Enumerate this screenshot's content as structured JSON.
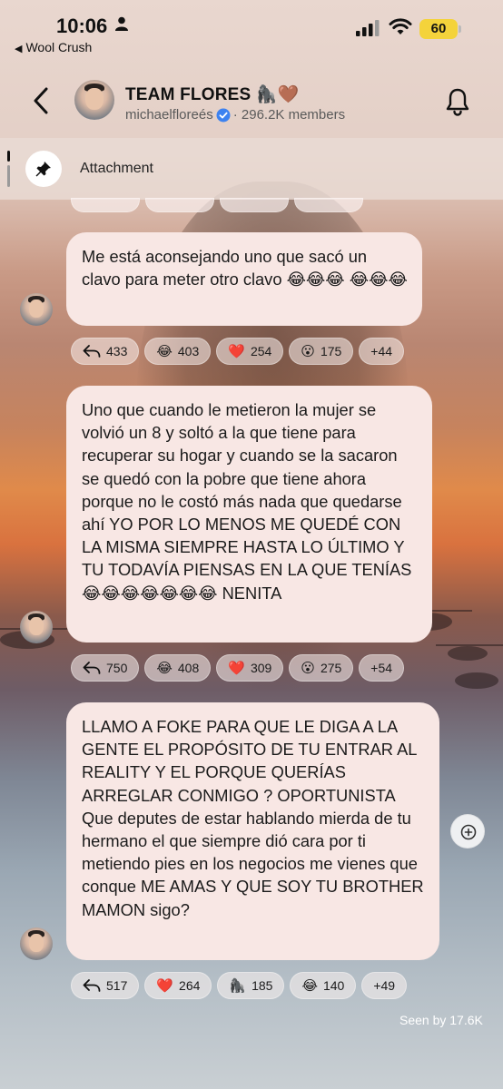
{
  "status_bar": {
    "time": "10:06",
    "back_app": "Wool Crush",
    "battery": "60"
  },
  "header": {
    "title": "TEAM FLORES 🦍🤎",
    "handle": "michaelfloreés",
    "members": "· 296.2K members"
  },
  "pinned": {
    "label": "Attachment"
  },
  "messages": [
    {
      "text": "Me está aconsejando uno que sacó un clavo para meter otro clavo 😂😂😂 😂😂😂",
      "reactions": [
        {
          "icon": "reply-icon",
          "count": "433"
        },
        {
          "emoji": "😂",
          "count": "403"
        },
        {
          "emoji": "❤️",
          "count": "254"
        },
        {
          "emoji": "😮",
          "count": "175"
        },
        {
          "label": "+44"
        }
      ]
    },
    {
      "text": "Uno que cuando le metieron la mujer se volvió un 8 y soltó a la que tiene para recuperar su hogar y cuando se la sacaron se quedó con la pobre que tiene ahora porque no le costó más nada que quedarse ahí YO POR LO MENOS ME QUEDÉ CON LA MISMA SIEMPRE HASTA LO ÚLTIMO Y TU TODAVÍA  PIENSAS EN LA QUE TENÍAS 😂😂😂😂😂😂😂  NENITA",
      "reactions": [
        {
          "icon": "reply-icon",
          "count": "750"
        },
        {
          "emoji": "😂",
          "count": "408"
        },
        {
          "emoji": "❤️",
          "count": "309"
        },
        {
          "emoji": "😮",
          "count": "275"
        },
        {
          "label": "+54"
        }
      ]
    },
    {
      "text": "LLAMO A FOKE PARA QUE LE DIGA A LA GENTE EL PROPÓSITO DE TU ENTRAR AL REALITY Y EL PORQUE QUERÍAS ARREGLAR CONMIGO ? OPORTUNISTA   Que deputes de estar hablando mierda de tu hermano el que siempre dió cara por ti metiendo pies en los negocios me vienes que conque ME AMAS Y QUE SOY TU BROTHER MAMON  sigo?",
      "reactions": [
        {
          "icon": "reply-icon",
          "count": "517"
        },
        {
          "emoji": "❤️",
          "count": "264"
        },
        {
          "emoji": "🦍",
          "count": "185"
        },
        {
          "emoji": "😂",
          "count": "140"
        },
        {
          "label": "+49"
        }
      ]
    }
  ],
  "seen": "Seen by 17.6K",
  "colors": {
    "bubble": "#f8e7e4",
    "verified": "#3d82f0",
    "battery": "#f4d33b"
  }
}
